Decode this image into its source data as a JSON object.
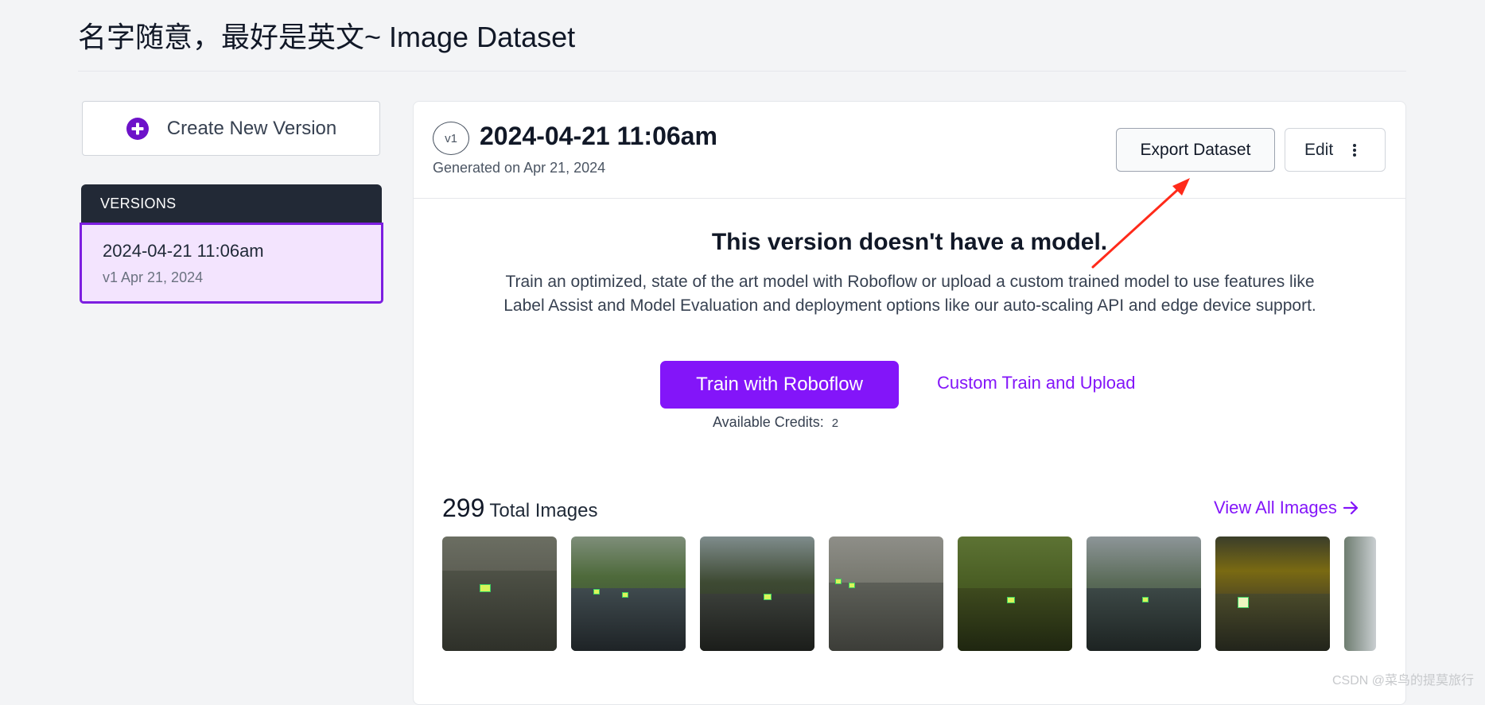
{
  "page": {
    "title": "名字随意，最好是英文~ Image Dataset"
  },
  "sidebar": {
    "create_button_label": "Create New Version",
    "versions_header": "VERSIONS",
    "items": [
      {
        "title": "2024-04-21 11:06am",
        "subtitle": "v1 Apr 21, 2024"
      }
    ]
  },
  "version_card": {
    "badge": "v1",
    "title": "2024-04-21 11:06am",
    "generated": "Generated on Apr 21, 2024",
    "export_label": "Export Dataset",
    "edit_label": "Edit",
    "no_model_title": "This version doesn't have a model.",
    "no_model_description": "Train an optimized, state of the art model with Roboflow or upload a custom trained model to use features like Label Assist and Model Evaluation and deployment options like our auto-scaling API and edge device support.",
    "train_button_label": "Train with Roboflow",
    "custom_link_label": "Custom Train and Upload",
    "credits_label": "Available Credits:",
    "credits_value": "2",
    "total_images_count": "299",
    "total_images_label": "Total Images",
    "view_all_label": "View All Images"
  },
  "colors": {
    "accent": "#8315f9",
    "selected_bg": "#f3e4fe",
    "dark_header": "#222936",
    "annotation_red": "#ff2a1a"
  },
  "icons": {
    "create": "plus-circle-icon",
    "edit_menu": "kebab-menu-icon",
    "view_all": "arrow-right-icon"
  },
  "watermark": "CSDN @菜鸟的提莫旅行"
}
